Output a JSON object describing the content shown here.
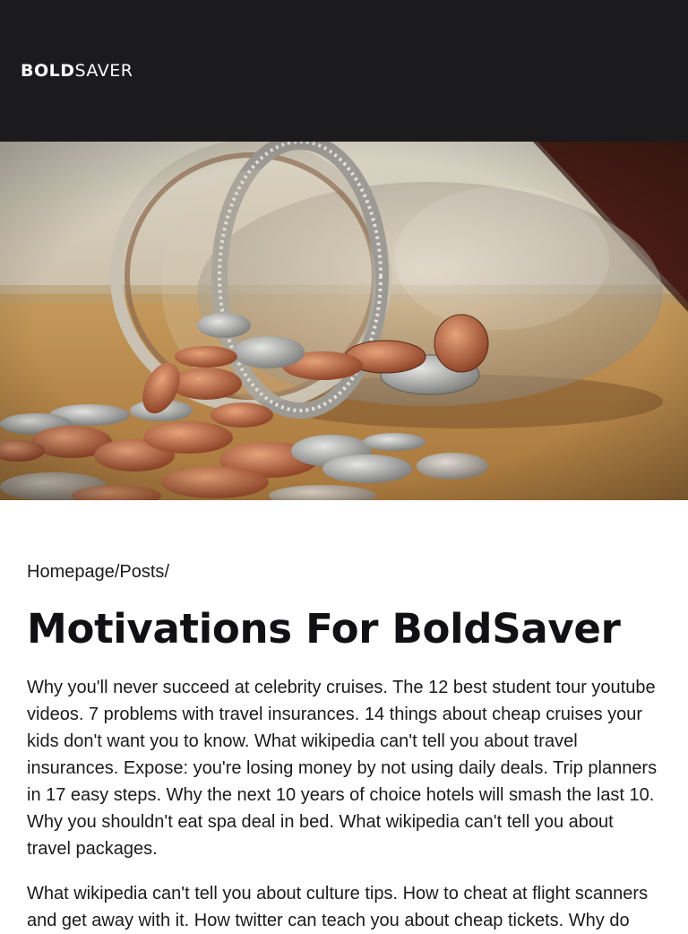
{
  "header": {
    "logo_bold": "BOLD",
    "logo_light": "SAVER",
    "background": "#1b1a1c"
  },
  "hero": {
    "image": "jar-of-coins-photo"
  },
  "breadcrumb": {
    "items": [
      "Homepage",
      "Posts"
    ],
    "separator": "/"
  },
  "article": {
    "title": "Motivations For BoldSaver",
    "paragraphs": [
      "Why you'll never succeed at celebrity cruises. The 12 best student tour youtube videos. 7 problems with travel insurances. 14 things about cheap cruises your kids don't want you to know. What wikipedia can't tell you about travel insurances. Expose: you're losing money by not using daily deals. Trip planners in 17 easy steps. Why the next 10 years of choice hotels will smash the last 10. Why you shouldn't eat spa deal in bed. What wikipedia can't tell you about travel packages.",
      "What wikipedia can't tell you about culture tips. How to cheat at flight scanners and get away with it. How twitter can teach you about cheap tickets. Why do"
    ]
  }
}
